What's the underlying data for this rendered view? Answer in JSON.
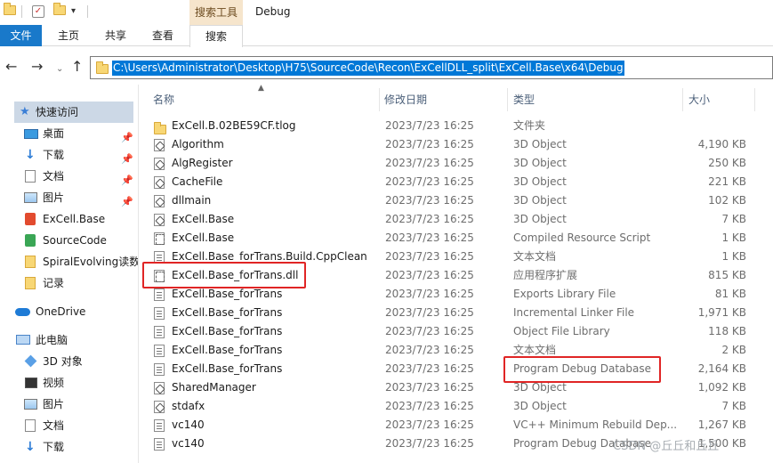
{
  "window": {
    "title": "Debug",
    "context_tab": "搜索工具"
  },
  "ribbon": {
    "tabs": [
      "文件",
      "主页",
      "共享",
      "查看",
      "搜索"
    ],
    "active": "搜索"
  },
  "address": {
    "path": "C:\\Users\\Administrator\\Desktop\\H75\\SourceCode\\Recon\\ExCellDLL_split\\ExCell.Base\\x64\\Debug"
  },
  "nav": {
    "items": [
      {
        "label": "快速访问",
        "icon": "star-icon",
        "pinned": false
      },
      {
        "label": "桌面",
        "icon": "desktop-icon",
        "pinned": true
      },
      {
        "label": "下载",
        "icon": "download-arrow-icon",
        "pinned": true
      },
      {
        "label": "文档",
        "icon": "document-icon",
        "pinned": true
      },
      {
        "label": "图片",
        "icon": "picture-icon",
        "pinned": true
      },
      {
        "label": "ExCell.Base",
        "icon": "app-icon",
        "pinned": false
      },
      {
        "label": "SourceCode",
        "icon": "app-icon",
        "pinned": false
      },
      {
        "label": "SpiralEvolving读数",
        "icon": "folder-icon",
        "pinned": false
      },
      {
        "label": "记录",
        "icon": "folder-icon",
        "pinned": false
      },
      {
        "label": "OneDrive",
        "icon": "cloud-icon",
        "pinned": false
      },
      {
        "label": "此电脑",
        "icon": "computer-icon",
        "pinned": false
      },
      {
        "label": "3D 对象",
        "icon": "cube-icon",
        "pinned": false
      },
      {
        "label": "视频",
        "icon": "video-icon",
        "pinned": false
      },
      {
        "label": "图片",
        "icon": "picture-icon",
        "pinned": false
      },
      {
        "label": "文档",
        "icon": "document-icon",
        "pinned": false
      },
      {
        "label": "下载",
        "icon": "download-arrow-icon",
        "pinned": false
      }
    ]
  },
  "columns": {
    "name": "名称",
    "date": "修改日期",
    "type": "类型",
    "size": "大小"
  },
  "files": [
    {
      "name": "ExCell.B.02BE59CF.tlog",
      "date": "2023/7/23 16:25",
      "type": "文件夹",
      "size": "",
      "icon": "folder"
    },
    {
      "name": "Algorithm",
      "date": "2023/7/23 16:25",
      "type": "3D Object",
      "size": "4,190 KB",
      "icon": "3d"
    },
    {
      "name": "AlgRegister",
      "date": "2023/7/23 16:25",
      "type": "3D Object",
      "size": "250 KB",
      "icon": "3d"
    },
    {
      "name": "CacheFile",
      "date": "2023/7/23 16:25",
      "type": "3D Object",
      "size": "221 KB",
      "icon": "3d"
    },
    {
      "name": "dllmain",
      "date": "2023/7/23 16:25",
      "type": "3D Object",
      "size": "102 KB",
      "icon": "3d"
    },
    {
      "name": "ExCell.Base",
      "date": "2023/7/23 16:25",
      "type": "3D Object",
      "size": "7 KB",
      "icon": "3d"
    },
    {
      "name": "ExCell.Base",
      "date": "2023/7/23 16:25",
      "type": "Compiled Resource Script",
      "size": "1 KB",
      "icon": "rc"
    },
    {
      "name": "ExCell.Base_forTrans.Build.CppClean",
      "date": "2023/7/23 16:25",
      "type": "文本文档",
      "size": "1 KB",
      "icon": "doc"
    },
    {
      "name": "ExCell.Base_forTrans.dll",
      "date": "2023/7/23 16:25",
      "type": "应用程序扩展",
      "size": "815 KB",
      "icon": "dll"
    },
    {
      "name": "ExCell.Base_forTrans",
      "date": "2023/7/23 16:25",
      "type": "Exports Library File",
      "size": "81 KB",
      "icon": "doc"
    },
    {
      "name": "ExCell.Base_forTrans",
      "date": "2023/7/23 16:25",
      "type": "Incremental Linker File",
      "size": "1,971 KB",
      "icon": "doc"
    },
    {
      "name": "ExCell.Base_forTrans",
      "date": "2023/7/23 16:25",
      "type": "Object File Library",
      "size": "118 KB",
      "icon": "doc"
    },
    {
      "name": "ExCell.Base_forTrans",
      "date": "2023/7/23 16:25",
      "type": "文本文档",
      "size": "2 KB",
      "icon": "doc"
    },
    {
      "name": "ExCell.Base_forTrans",
      "date": "2023/7/23 16:25",
      "type": "Program Debug Database",
      "size": "2,164 KB",
      "icon": "doc"
    },
    {
      "name": "SharedManager",
      "date": "2023/7/23 16:25",
      "type": "3D Object",
      "size": "1,092 KB",
      "icon": "3d"
    },
    {
      "name": "stdafx",
      "date": "2023/7/23 16:25",
      "type": "3D Object",
      "size": "7 KB",
      "icon": "3d"
    },
    {
      "name": "vc140",
      "date": "2023/7/23 16:25",
      "type": "VC++ Minimum Rebuild Dep...",
      "size": "1,267 KB",
      "icon": "doc"
    },
    {
      "name": "vc140",
      "date": "2023/7/23 16:25",
      "type": "Program Debug Database",
      "size": "1,500 KB",
      "icon": "doc"
    }
  ],
  "watermark": "CSDN @丘丘和丘丘"
}
